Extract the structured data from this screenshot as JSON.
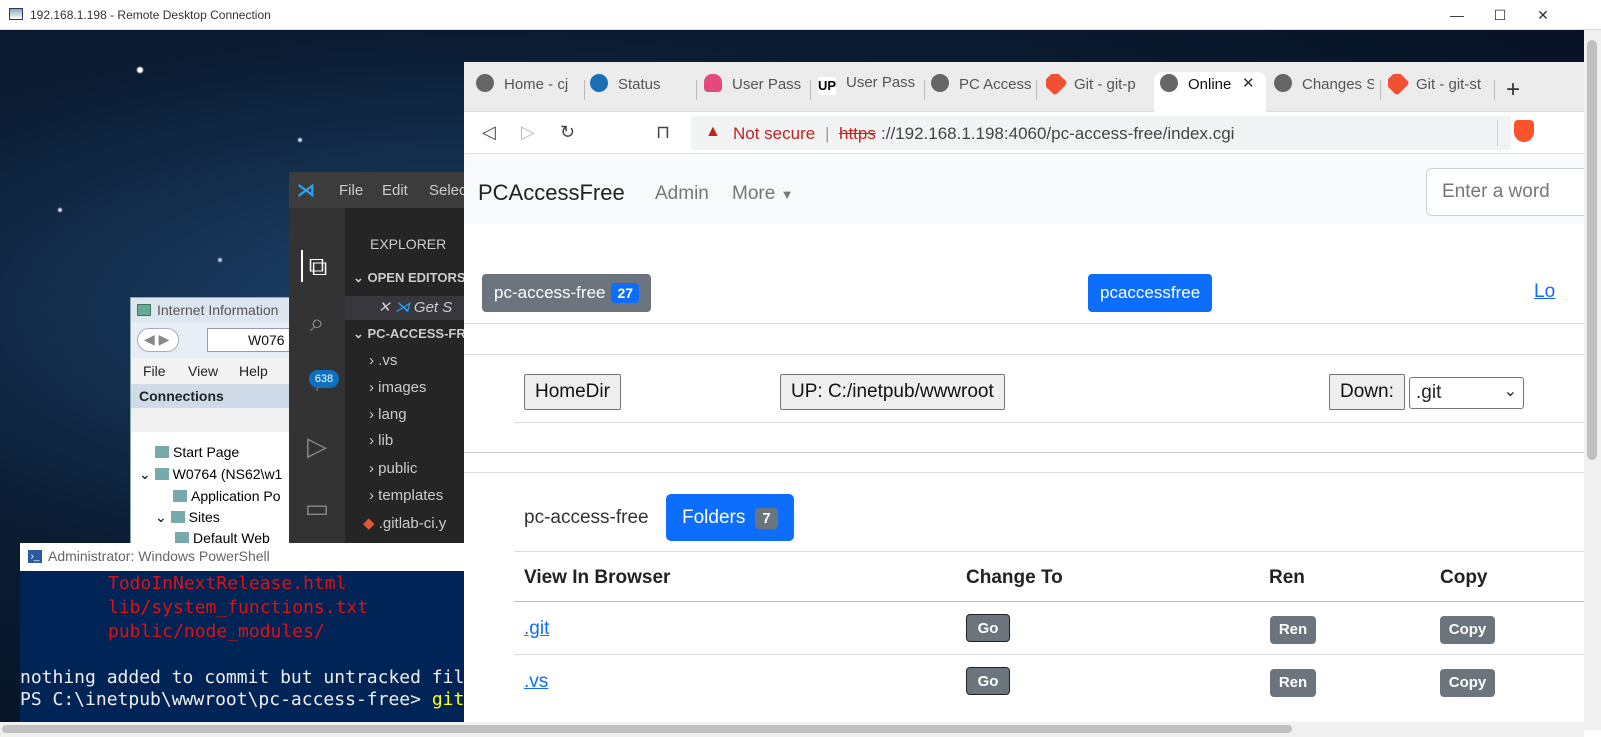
{
  "rdp": {
    "title": "192.168.1.198 - Remote Desktop Connection"
  },
  "window_controls": {
    "minimize": "—",
    "maximize": "☐",
    "close": "✕"
  },
  "iis": {
    "title": "Internet Information",
    "address": "W076",
    "menu": [
      "File",
      "View",
      "Help"
    ],
    "connections_label": "Connections",
    "tree": [
      "Start Page",
      "W0764 (NS62\\w1",
      "Application Po",
      "Sites",
      "Default Web"
    ]
  },
  "vscode": {
    "menu": [
      "File",
      "Edit",
      "Selec"
    ],
    "explorer_label": "EXPLORER",
    "open_editors_label": "OPEN EDITORS",
    "open_editor_item": "Get S",
    "project_label": "PC-ACCESS-FR",
    "folders": [
      ".vs",
      "images",
      "lang",
      "lib",
      "public",
      "templates"
    ],
    "file": ".gitlab-ci.y",
    "scm_badge": "638"
  },
  "powershell": {
    "title": "Administrator: Windows PowerShell",
    "lines_red": [
      "TodoInNextRelease.html",
      "lib/system_functions.txt",
      "public/node_modules/"
    ],
    "line_white": "nothing added to commit but untracked fil",
    "prompt": "PS C:\\inetpub\\wwwroot\\pc-access-free> ",
    "command": "git"
  },
  "browser": {
    "tabs": [
      "Home - cj",
      "Status",
      "User Pass",
      "User Pass",
      "PC Access",
      "Git - git-p",
      "Online",
      "Changes S",
      "Git - git-st"
    ],
    "new_tab": "+",
    "tab_close": "✕",
    "not_secure": "Not secure",
    "url_scheme": "https",
    "url_rest": "://192.168.1.198:4060/pc-access-free/index.cgi"
  },
  "page": {
    "brand": "PCAccessFree",
    "nav_admin": "Admin",
    "nav_more": "More",
    "search_placeholder": "Enter a word",
    "repo_button": "pc-access-free",
    "repo_count": "27",
    "user_button": "pcaccessfree",
    "right_link": "Lo",
    "homedir": "HomeDir",
    "up": "UP: C:/inetpub/wwwroot",
    "down_label": "Down:",
    "down_value": ".git",
    "dir_name": "pc-access-free",
    "folders_label": "Folders",
    "folders_count": "7",
    "table": {
      "headers": [
        "View In Browser",
        "Change To",
        "Ren",
        "Copy"
      ],
      "rows": [
        {
          "name": ".git",
          "go": "Go",
          "ren": "Ren",
          "copy": "Copy"
        },
        {
          "name": ".vs",
          "go": "Go",
          "ren": "Ren",
          "copy": "Copy"
        }
      ]
    }
  }
}
